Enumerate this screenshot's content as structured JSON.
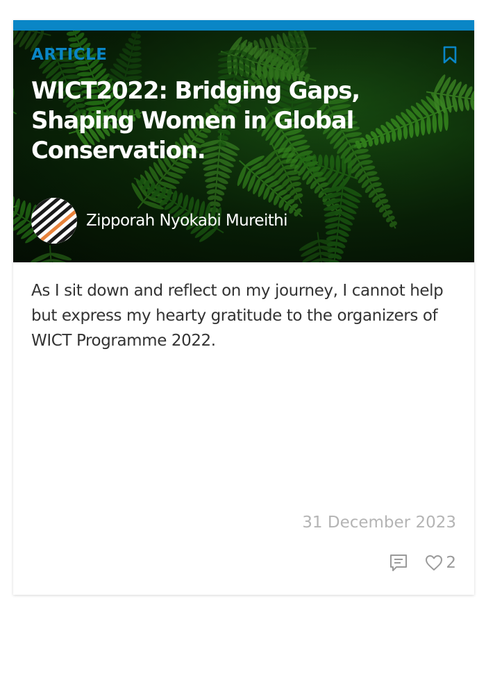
{
  "card": {
    "category": "ARTICLE",
    "title": "WICT2022: Bridging Gaps, Shaping Women in Global Conservation.",
    "author": "Zipporah Nyokabi Mureithi",
    "excerpt": "As I sit down and reflect on my journey, I cannot help but express my hearty gratitude to the organizers of WICT Programme 2022.",
    "date": "31 December 2023",
    "like_count": "2"
  },
  "colors": {
    "accent": "#0a86c6",
    "title_text": "#ffffff",
    "body_text": "#333333",
    "date_text": "#b4b4b4",
    "icon": "#9a9a9a",
    "avatar_stripe_dark": "#1a1a1a",
    "avatar_stripe_orange": "#e8823a"
  },
  "icons": {
    "bookmark": "bookmark-icon",
    "comment": "comment-icon",
    "like": "heart-icon"
  }
}
